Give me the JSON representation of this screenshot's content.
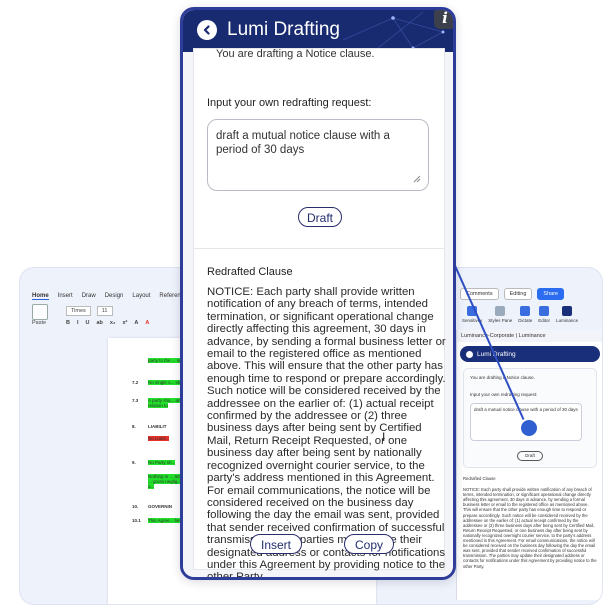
{
  "word": {
    "ribbon_tabs": [
      "Home",
      "Insert",
      "Draw",
      "Design",
      "Layout",
      "References"
    ],
    "paste_label": "Paste",
    "font_name": "Times",
    "font_size": "11",
    "format_buttons": [
      "B",
      "I",
      "U",
      "ab",
      "x₂",
      "x²",
      "A",
      "A"
    ],
    "right_buttons": {
      "comments": "Comments",
      "editing": "Editing",
      "share": "Share"
    },
    "right_ribbon": [
      "Sensitivity",
      "Styles Pane",
      "Dictate",
      "Editor",
      "Luminance"
    ],
    "doc_numbers": [
      "7.2",
      "7.3",
      "8.",
      "9.",
      "10.",
      "10.1"
    ],
    "doc_snippets": [
      "party to the ... right or rem",
      "No single o... shall prec",
      "A party sha... another par... relation to",
      "LIABILIT",
      "No Liabil...",
      "No Party sh...",
      "Nothing in ... any persona ... gross neglig... unlawful a...",
      "GOVERNIN",
      "This Agree... be governed"
    ]
  },
  "mini_panel": {
    "header": "Luminance-Corporate | Luminance",
    "bar_title": "Lumi Drafting",
    "intro": "You are drafting a Notice clause.",
    "request_label": "Input your own redrafting request:",
    "request_value": "draft a mutual notice clause with a period of 30 days",
    "draft": "Draft",
    "redraft_label": "Redrafted Clause",
    "redraft_text": "NOTICE: Each party shall provide written notification of any breach of terms, intended termination, or significant operational change directly affecting this agreement, 30 days in advance, by sending a formal business letter or email to the registered office as mentioned above. This will ensure that the other party has enough time to respond or prepare accordingly. Such notice will be considered received by the addressee on the earlier of: (1) actual receipt confirmed by the addressee or (2) three business days after being sent by Certified Mail, Return Receipt Requested, or one business day after being sent by nationally recognized overnight courier service, to the party's address mentioned in this Agreement. For email communications, the notice will be considered received on the business day following the day the email was sent, provided that sender received confirmation of successful transmission. The parties may update their designated address or contacts for notifications under this Agreement by providing notice to the other Party."
  },
  "lumi": {
    "title": "Lumi Drafting",
    "info": "i",
    "cut_text": "You are drafting a Notice clause.",
    "request_label": "Input your own redrafting request:",
    "request_value": "draft a mutual notice clause with a period of 30 days",
    "draft_button": "Draft",
    "redraft_label": "Redrafted Clause",
    "redraft_text": "NOTICE: Each party shall provide written notification of any breach of terms, intended termination, or significant operational change directly affecting this agreement, 30 days in advance, by sending a formal business letter or email to the registered office as mentioned above. This will ensure that the other party has enough time to respond or prepare accordingly. Such notice will be considered received by the addressee on the earlier of: (1) actual receipt confirmed by the addressee or (2) three business days after being sent by Certified Mail, Return Receipt Requested, or one business day after being sent by nationally recognized overnight courier service, to the party's address mentioned in this Agreement. For email communications, the notice will be considered received on the business day following the day the email was sent, provided that sender received confirmation of successful transmission. The parties may update their designated address or contacts for notifications under this Agreement by providing notice to the other Party.",
    "insert_button": "Insert",
    "copy_button": "Copy"
  },
  "colors": {
    "header_navy": "#182a70",
    "frame_blue": "#2f3d9a",
    "highlight_green": "#22e02a",
    "highlight_red": "#e5312b",
    "share_blue": "#2b6cf0"
  }
}
